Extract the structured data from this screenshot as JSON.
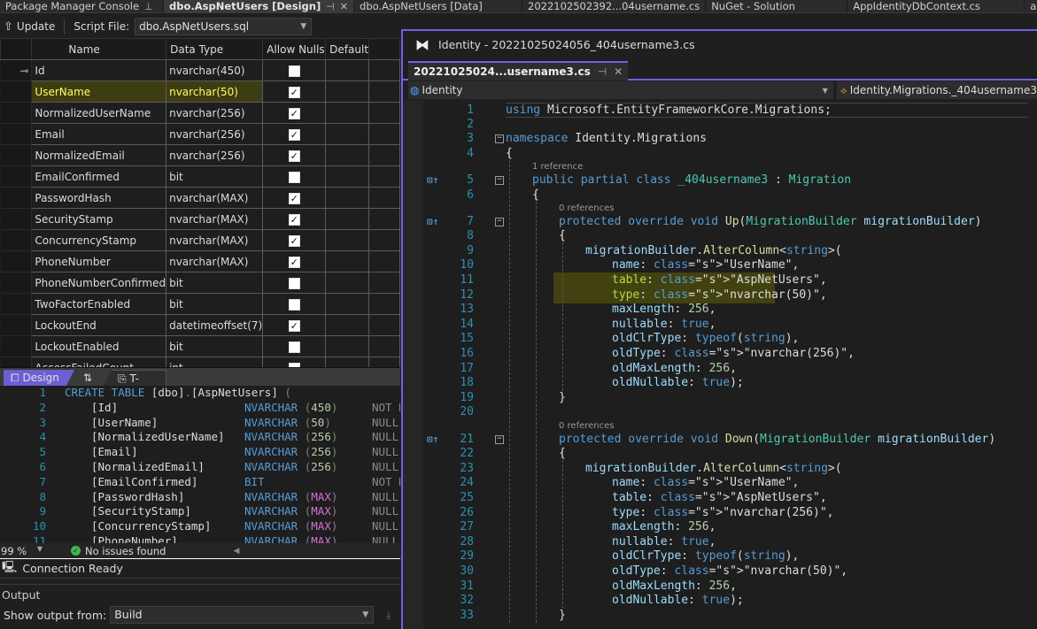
{
  "top_tabs": [
    {
      "label": "Package Manager Console",
      "pinned": true,
      "active": false
    },
    {
      "label": "dbo.AspNetUsers [Design]",
      "pinned": true,
      "active": true,
      "closable": true
    },
    {
      "label": "dbo.AspNetUsers [Data]",
      "active": false
    },
    {
      "label": "2022102502392...04username.cs",
      "active": false
    },
    {
      "label": "NuGet - Solution",
      "active": false
    },
    {
      "label": "AppIdentityDbContext.cs",
      "active": false
    },
    {
      "label": "appsettings.json",
      "active": false
    }
  ],
  "design_toolbar": {
    "update_label": "Update",
    "script_file_label": "Script File:",
    "script_file_value": "dbo.AspNetUsers.sql"
  },
  "grid": {
    "headers": [
      "Name",
      "Data Type",
      "Allow Nulls",
      "Default"
    ],
    "rows": [
      {
        "name": "Id",
        "type": "nvarchar(450)",
        "allow_nulls": false,
        "primary_key": true
      },
      {
        "name": "UserName",
        "type": "nvarchar(50)",
        "allow_nulls": true,
        "highlighted": true
      },
      {
        "name": "NormalizedUserName",
        "type": "nvarchar(256)",
        "allow_nulls": true
      },
      {
        "name": "Email",
        "type": "nvarchar(256)",
        "allow_nulls": true
      },
      {
        "name": "NormalizedEmail",
        "type": "nvarchar(256)",
        "allow_nulls": true
      },
      {
        "name": "EmailConfirmed",
        "type": "bit",
        "allow_nulls": false
      },
      {
        "name": "PasswordHash",
        "type": "nvarchar(MAX)",
        "allow_nulls": true
      },
      {
        "name": "SecurityStamp",
        "type": "nvarchar(MAX)",
        "allow_nulls": true
      },
      {
        "name": "ConcurrencyStamp",
        "type": "nvarchar(MAX)",
        "allow_nulls": true
      },
      {
        "name": "PhoneNumber",
        "type": "nvarchar(MAX)",
        "allow_nulls": true
      },
      {
        "name": "PhoneNumberConfirmed",
        "type": "bit",
        "allow_nulls": false
      },
      {
        "name": "TwoFactorEnabled",
        "type": "bit",
        "allow_nulls": false
      },
      {
        "name": "LockoutEnd",
        "type": "datetimeoffset(7)",
        "allow_nulls": true
      },
      {
        "name": "LockoutEnabled",
        "type": "bit",
        "allow_nulls": false
      },
      {
        "name": "AccessFailedCount",
        "type": "int",
        "allow_nulls": false
      }
    ]
  },
  "design_tabs": {
    "design": "Design",
    "swap": "⇅",
    "tsql": "T-SQL"
  },
  "tsql": {
    "lines": [
      {
        "n": "1",
        "col": "CREATE TABLE [dbo].[AspNetUsers] (",
        "type": "",
        "size": "",
        "null": ""
      },
      {
        "n": "2",
        "col": "[Id]",
        "type": "NVARCHAR",
        "size": "450",
        "null": "NOT NULL"
      },
      {
        "n": "3",
        "col": "[UserName]",
        "type": "NVARCHAR",
        "size": "50",
        "null": "NULL"
      },
      {
        "n": "4",
        "col": "[NormalizedUserName]",
        "type": "NVARCHAR",
        "size": "256",
        "null": "NULL"
      },
      {
        "n": "5",
        "col": "[Email]",
        "type": "NVARCHAR",
        "size": "256",
        "null": "NULL"
      },
      {
        "n": "6",
        "col": "[NormalizedEmail]",
        "type": "NVARCHAR",
        "size": "256",
        "null": "NULL"
      },
      {
        "n": "7",
        "col": "[EmailConfirmed]",
        "type": "BIT",
        "size": "",
        "null": "NOT NULL"
      },
      {
        "n": "8",
        "col": "[PasswordHash]",
        "type": "NVARCHAR",
        "size": "MAX",
        "null": "NULL"
      },
      {
        "n": "9",
        "col": "[SecurityStamp]",
        "type": "NVARCHAR",
        "size": "MAX",
        "null": "NULL"
      },
      {
        "n": "10",
        "col": "[ConcurrencyStamp]",
        "type": "NVARCHAR",
        "size": "MAX",
        "null": "NULL"
      },
      {
        "n": "11",
        "col": "[PhoneNumber]",
        "type": "NVARCHAR",
        "size": "MAX",
        "null": "NULL"
      }
    ]
  },
  "left_status": {
    "zoom": "99 %",
    "issues": "No issues found"
  },
  "connection": {
    "label": "Connection Ready"
  },
  "output": {
    "title": "Output",
    "show_from_label": "Show output from:",
    "show_from_value": "Build"
  },
  "right_window": {
    "title": "Identity - 20221025024056_404username3.cs",
    "tab_label": "20221025024...username3.cs",
    "nav_project": "Identity",
    "nav_member": "Identity.Migrations._404username3",
    "references": {
      "class": "1 reference",
      "up": "0 references",
      "down": "0 references"
    },
    "code": [
      "using Microsoft.EntityFrameworkCore.Migrations;",
      "",
      "namespace Identity.Migrations",
      "{",
      "public partial class _404username3 : Migration",
      "{",
      "protected override void Up(MigrationBuilder migrationBuilder)",
      "{",
      "migrationBuilder.AlterColumn<string>(",
      "name: \"UserName\",",
      "table: \"AspNetUsers\",",
      "type: \"nvarchar(50)\",",
      "maxLength: 256,",
      "nullable: true,",
      "oldClrType: typeof(string),",
      "oldType: \"nvarchar(256)\",",
      "oldMaxLength: 256,",
      "oldNullable: true);",
      "}",
      "",
      "protected override void Down(MigrationBuilder migrationBuilder)",
      "{",
      "migrationBuilder.AlterColumn<string>(",
      "name: \"UserName\",",
      "table: \"AspNetUsers\",",
      "type: \"nvarchar(256)\",",
      "maxLength: 256,",
      "nullable: true,",
      "oldClrType: typeof(string),",
      "oldType: \"nvarchar(50)\",",
      "oldMaxLength: 256,",
      "oldNullable: true);",
      "}"
    ]
  }
}
